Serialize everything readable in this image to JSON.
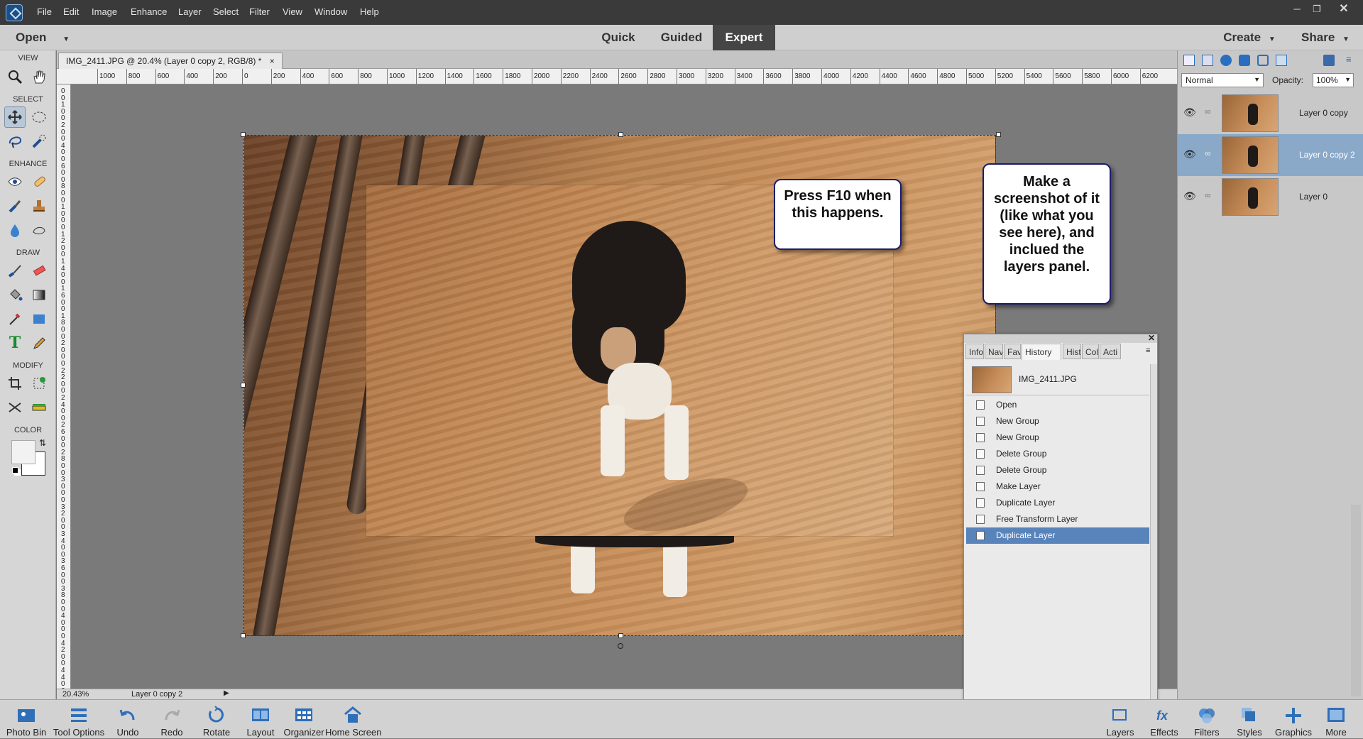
{
  "menubar": {
    "items": [
      "File",
      "Edit",
      "Image",
      "Enhance",
      "Layer",
      "Select",
      "Filter",
      "View",
      "Window",
      "Help"
    ]
  },
  "modebar": {
    "open_label": "Open",
    "modes": [
      "Quick",
      "Guided",
      "Expert"
    ],
    "active_mode": "Expert",
    "create_label": "Create",
    "share_label": "Share"
  },
  "toolbox": {
    "sections": [
      "VIEW",
      "SELECT",
      "ENHANCE",
      "DRAW",
      "MODIFY",
      "COLOR"
    ],
    "icons": [
      "zoom-icon",
      "hand-icon",
      "move-icon",
      "marquee-icon",
      "lasso-icon",
      "quick-selection-icon",
      "eye-icon",
      "spot-healing-icon",
      "smart-brush-icon",
      "clone-stamp-icon",
      "blur-icon",
      "sponge-icon",
      "brush-icon",
      "eraser-icon",
      "paint-bucket-icon",
      "gradient-icon",
      "eyedropper-icon",
      "shape-icon",
      "type-icon",
      "pencil-icon",
      "crop-icon",
      "recompose-icon",
      "content-aware-move-icon",
      "straighten-icon"
    ]
  },
  "document": {
    "tab_title": "IMG_2411.JPG @ 20.4% (Layer 0 copy 2, RGB/8) *",
    "close_glyph": "×"
  },
  "rulers": {
    "horizontal": [
      "1000",
      "800",
      "600",
      "400",
      "200",
      "0",
      "200",
      "400",
      "600",
      "800",
      "1000",
      "1200",
      "1400",
      "1600",
      "1800",
      "2000",
      "2200",
      "2400",
      "2600",
      "2800",
      "3000",
      "3200",
      "3400",
      "3600",
      "3800",
      "4000",
      "4200",
      "4400",
      "4600",
      "4800",
      "5000",
      "5200",
      "5400",
      "5600",
      "5800",
      "6000",
      "6200"
    ],
    "vertical": [
      "0",
      "0",
      "1",
      "0",
      "0",
      "2",
      "0",
      "0",
      "4",
      "0",
      "0",
      "6",
      "0",
      "0",
      "8",
      "0",
      "0",
      "1",
      "0",
      "0",
      "0",
      "1",
      "2",
      "0",
      "0",
      "1",
      "4",
      "0",
      "0",
      "1",
      "6",
      "0",
      "0",
      "1",
      "8",
      "0",
      "0",
      "2",
      "0",
      "0",
      "0",
      "2",
      "2",
      "0",
      "0",
      "2",
      "4",
      "0",
      "0",
      "2",
      "6",
      "0",
      "0",
      "2",
      "8",
      "0",
      "0",
      "3",
      "0",
      "0",
      "0",
      "3",
      "2",
      "0",
      "0",
      "3",
      "4",
      "0",
      "0",
      "3",
      "6",
      "0",
      "0",
      "3",
      "8",
      "0",
      "0",
      "4",
      "0",
      "0",
      "0",
      "4",
      "2",
      "0",
      "0",
      "4",
      "4",
      "0",
      "0"
    ]
  },
  "callouts": {
    "first": "Press F10 when this happens.",
    "second": "Make a screenshot of it (like what you see here), and inclued the layers panel."
  },
  "status": {
    "zoom": "20.43%",
    "layer": "Layer 0 copy 2"
  },
  "layers_panel": {
    "blend_mode": "Normal",
    "opacity_label": "Opacity:",
    "opacity_value": "100%",
    "layers": [
      {
        "name": "Layer 0 copy",
        "selected": false
      },
      {
        "name": "Layer 0 copy 2",
        "selected": true
      },
      {
        "name": "Layer 0",
        "selected": false
      }
    ]
  },
  "history_panel": {
    "tabs": [
      "Info",
      "Nav",
      "Fav",
      "History",
      "Hist",
      "Col",
      "Acti"
    ],
    "active_tab": "History",
    "snapshot_name": "IMG_2411.JPG",
    "states": [
      "Open",
      "New Group",
      "New Group",
      "Delete Group",
      "Delete Group",
      "Make Layer",
      "Duplicate Layer",
      "Free Transform Layer",
      "Duplicate Layer"
    ],
    "selected_index": 8
  },
  "bottombar": {
    "left": [
      {
        "label": "Photo Bin",
        "icon": "photo-bin-icon"
      },
      {
        "label": "Tool Options",
        "icon": "tool-options-icon"
      },
      {
        "label": "Undo",
        "icon": "undo-icon"
      },
      {
        "label": "Redo",
        "icon": "redo-icon"
      },
      {
        "label": "Rotate",
        "icon": "rotate-icon"
      },
      {
        "label": "Layout",
        "icon": "layout-icon"
      },
      {
        "label": "Organizer",
        "icon": "organizer-icon"
      },
      {
        "label": "Home Screen",
        "icon": "home-icon"
      }
    ],
    "right": [
      {
        "label": "Layers",
        "icon": "layers-icon"
      },
      {
        "label": "Effects",
        "icon": "effects-icon"
      },
      {
        "label": "Filters",
        "icon": "filters-icon"
      },
      {
        "label": "Styles",
        "icon": "styles-icon"
      },
      {
        "label": "Graphics",
        "icon": "graphics-icon"
      },
      {
        "label": "More",
        "icon": "more-icon"
      }
    ]
  },
  "colors": {
    "accent": "#5983bb",
    "layer_selected": "#8aa9c9",
    "dark_chrome": "#3a3a3a",
    "callout_border": "#1c1c6b"
  }
}
